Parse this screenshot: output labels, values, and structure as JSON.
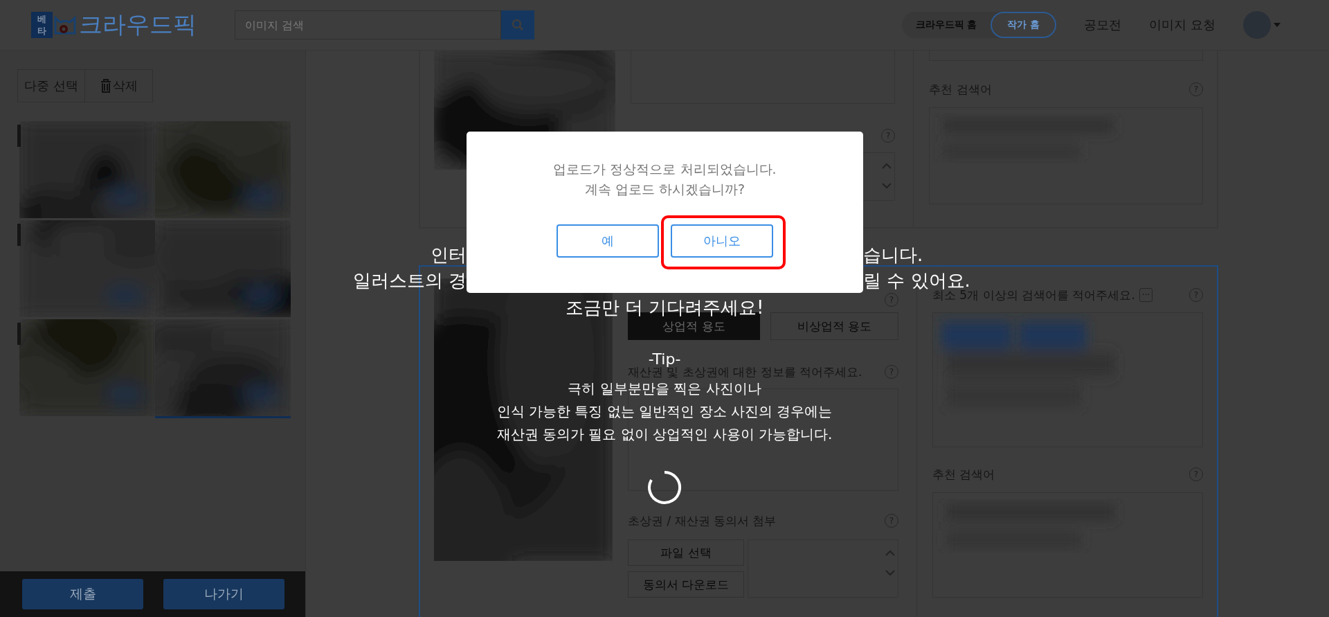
{
  "header": {
    "logo": {
      "badge": "베타",
      "name": "크라우드픽"
    },
    "search": {
      "placeholder": "이미지 검색"
    },
    "toggle": [
      {
        "label": "크라우드픽 홈",
        "selected": false
      },
      {
        "label": "작가 홈",
        "selected": true
      }
    ],
    "links": [
      "공모전",
      "이미지 요청"
    ]
  },
  "sidebar": {
    "tools": [
      {
        "label": "다중 선택",
        "kind": "text"
      },
      {
        "label": "삭제",
        "kind": "delete"
      }
    ],
    "thumbnails": [
      {
        "selected": false
      },
      {
        "selected": false
      },
      {
        "selected": false
      },
      {
        "selected": false
      },
      {
        "selected": false
      },
      {
        "selected": true
      }
    ],
    "actions": [
      "제출",
      "나가기"
    ]
  },
  "cards": [
    {
      "selected": false,
      "consent": {
        "help": "?"
      },
      "recommend": {
        "label": "추천 검색어",
        "help": "?"
      }
    },
    {
      "selected": true,
      "usage": {
        "help": "?",
        "options": [
          {
            "label": "상업적 용도",
            "selected": true
          },
          {
            "label": "비상업적 용도",
            "selected": false
          }
        ]
      },
      "info": {
        "label": "재산권 및 초상권에 대한 정보를 적어주세요.",
        "help": "?"
      },
      "consent": {
        "label": "초상권 / 재산권 동의서 첨부",
        "help": "?",
        "buttons": [
          "파일 선택",
          "동의서 다운로드"
        ]
      },
      "keywords": {
        "label": "최소 5개 이상의 검색어를 적어주세요.",
        "more": "···",
        "help": "?"
      },
      "recommend": {
        "label": "추천 검색어",
        "help": "?"
      }
    }
  ],
  "loading": {
    "lines": [
      {
        "left": "인터",
        "right": "습니다."
      },
      {
        "left": "일러스트의 경",
        "right": "릴 수 있어요."
      },
      {
        "text": "조금만 더 기다려주세요!"
      }
    ],
    "tip_title": "-Tip-",
    "tip": [
      "극히 일부분만을 찍은 사진이나",
      "인식 가능한 특징 없는 일반적인 장소 사진의 경우에는",
      "재산권 동의가 필요 없이 상업적인 사용이 가능합니다."
    ]
  },
  "dialog": {
    "message": [
      "업로드가 정상적으로 처리되었습니다.",
      "계속 업로드 하시겠습니까?"
    ],
    "buttons": [
      {
        "label": "예",
        "highlighted": false
      },
      {
        "label": "아니오",
        "highlighted": true
      }
    ]
  }
}
